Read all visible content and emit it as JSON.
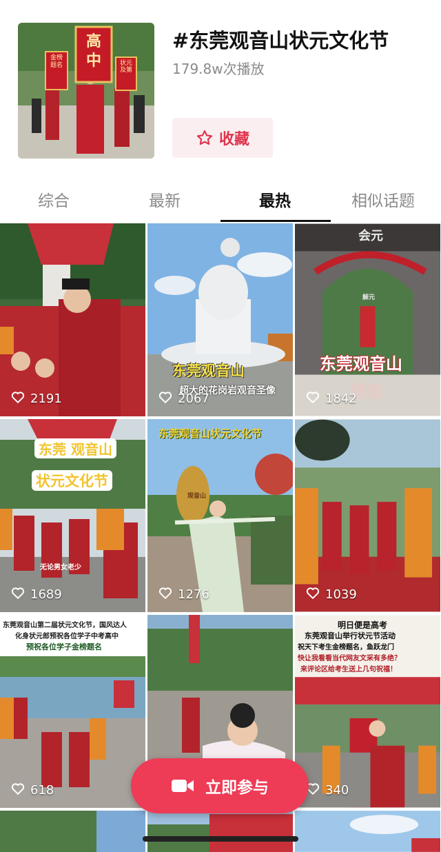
{
  "topic": {
    "title": "#东莞观音山状元文化节",
    "plays": "179.8w次播放",
    "favorite_label": "收藏",
    "cover_signs": [
      "高中",
      "金榜题名",
      "状元及第"
    ]
  },
  "tabs": [
    {
      "label": "综合",
      "active": false
    },
    {
      "label": "最新",
      "active": false
    },
    {
      "label": "最热",
      "active": true
    },
    {
      "label": "相似话题",
      "active": false
    }
  ],
  "videos": [
    {
      "likes": "2191",
      "caption": ""
    },
    {
      "likes": "2067",
      "caption": "东莞观音山",
      "sub": "超大的花岗岩观音圣像"
    },
    {
      "likes": "1842",
      "caption": "东莞观音山",
      "sub": "领旨",
      "gate": "会元",
      "inner_gate": "解元"
    },
    {
      "likes": "1689",
      "caption": "东莞 观音山",
      "sub": "状元文化节",
      "note": "无论男女老少"
    },
    {
      "likes": "1276",
      "caption": "东莞观音山状元文化节",
      "stone": "观音山"
    },
    {
      "likes": "1039",
      "caption": ""
    },
    {
      "likes": "618",
      "caption": "东莞观音山第二届状元文化节，国风达人",
      "sub": "化身状元郎预祝各位学子中考高中",
      "note": "预祝各位学子金榜题名"
    },
    {
      "likes": "",
      "caption": ""
    },
    {
      "likes": "340",
      "caption": "明日便是高考",
      "sub": "东莞观音山举行状元节活动",
      "note": "祝天下考生金榜题名，鱼跃龙门",
      "q1": "快让我看看当代网友文采有多绝？",
      "q2": "来评论区给考生送上几句祝福！"
    }
  ],
  "join_label": "立即参与",
  "colors": {
    "accent": "#ee3b56",
    "fav_bg": "#fbeef0",
    "fav_text": "#e0334d"
  }
}
